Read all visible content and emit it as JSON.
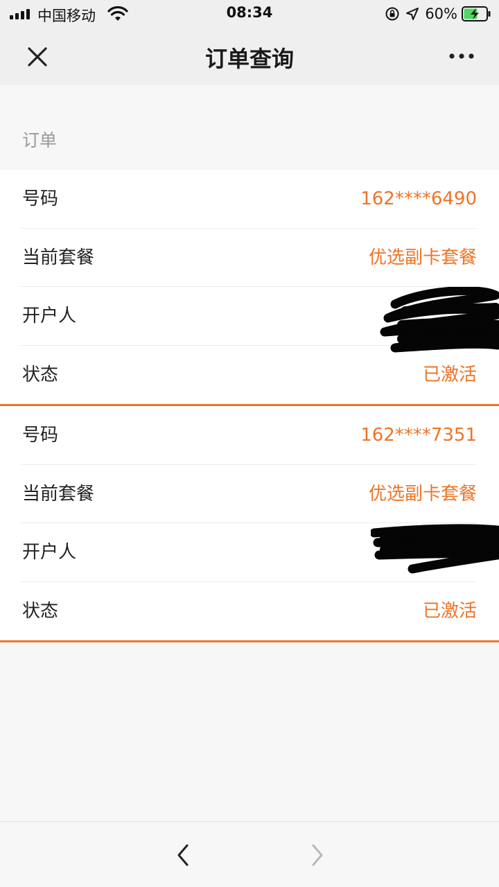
{
  "status_bar": {
    "carrier": "中国移动",
    "time": "08:34",
    "battery": "60%"
  },
  "header": {
    "title": "订单查询",
    "close_icon": "close-icon",
    "more_icon": "more-icon"
  },
  "section": {
    "label": "订单"
  },
  "orders": [
    {
      "number_label": "号码",
      "number_value": "162****6490",
      "plan_label": "当前套餐",
      "plan_value": "优选副卡套餐",
      "owner_label": "开户人",
      "status_label": "状态",
      "status_value": "已激活"
    },
    {
      "number_label": "号码",
      "number_value": "162****7351",
      "plan_label": "当前套餐",
      "plan_value": "优选副卡套餐",
      "owner_label": "开户人",
      "status_label": "状态",
      "status_value": "已激活"
    }
  ],
  "colors": {
    "accent": "#ee7427",
    "header_bg": "#efefef",
    "page_bg": "#f7f7f7"
  }
}
